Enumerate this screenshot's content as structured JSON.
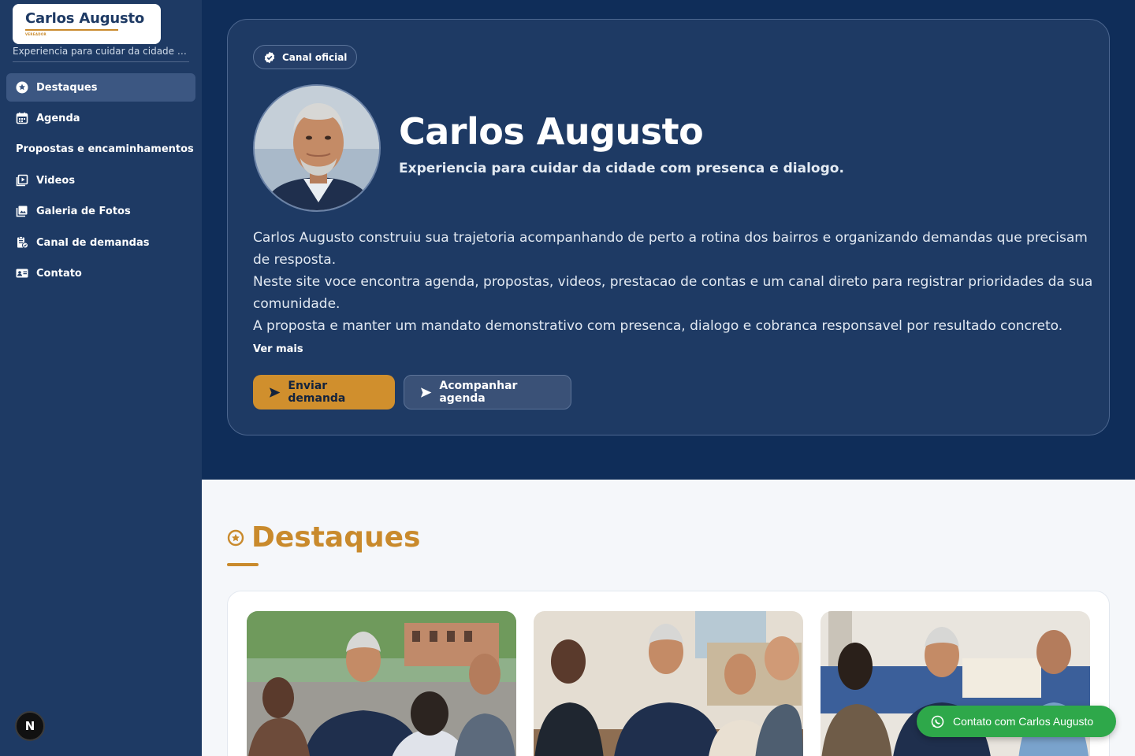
{
  "brand": {
    "logo_name": "Carlos Augusto",
    "logo_subtitle": "VEREADOR",
    "tagline": "Experiencia para cuidar da cidade com presenca e dialogo.",
    "accent_color": "#c98a2c",
    "sidebar_color": "#1e3a64"
  },
  "sidebar": {
    "items": [
      {
        "label": "Destaques",
        "icon": "star-badge-icon",
        "active": true
      },
      {
        "label": "Agenda",
        "icon": "calendar-icon"
      },
      {
        "label": "Propostas e encaminhamentos",
        "icon": ""
      },
      {
        "label": "Videos",
        "icon": "video-icon"
      },
      {
        "label": "Galeria de Fotos",
        "icon": "photo-gallery-icon"
      },
      {
        "label": "Canal de demandas",
        "icon": "request-icon"
      },
      {
        "label": "Contato",
        "icon": "contact-card-icon"
      }
    ],
    "n_badge": "N"
  },
  "hero": {
    "chip": "Canal oficial",
    "name": "Carlos Augusto",
    "subtitle": "Experiencia para cuidar da cidade com presenca e dialogo.",
    "paragraphs": [
      "Carlos Augusto construiu sua trajetoria acompanhando de perto a rotina dos bairros e organizando demandas que precisam de resposta.",
      "Neste site voce encontra agenda, propostas, videos, prestacao de contas e um canal direto para registrar prioridades da sua comunidade.",
      "A proposta e manter um mandato demonstrativo com presenca, dialogo e cobranca responsavel por resultado concreto."
    ],
    "ver_mais": "Ver mais",
    "btn_primary": "Enviar demanda",
    "btn_secondary": "Acompanhar agenda"
  },
  "destaques": {
    "title": "Destaques"
  },
  "floating_contact": {
    "label": "Contato com Carlos Augusto",
    "color": "#2ea84a"
  }
}
